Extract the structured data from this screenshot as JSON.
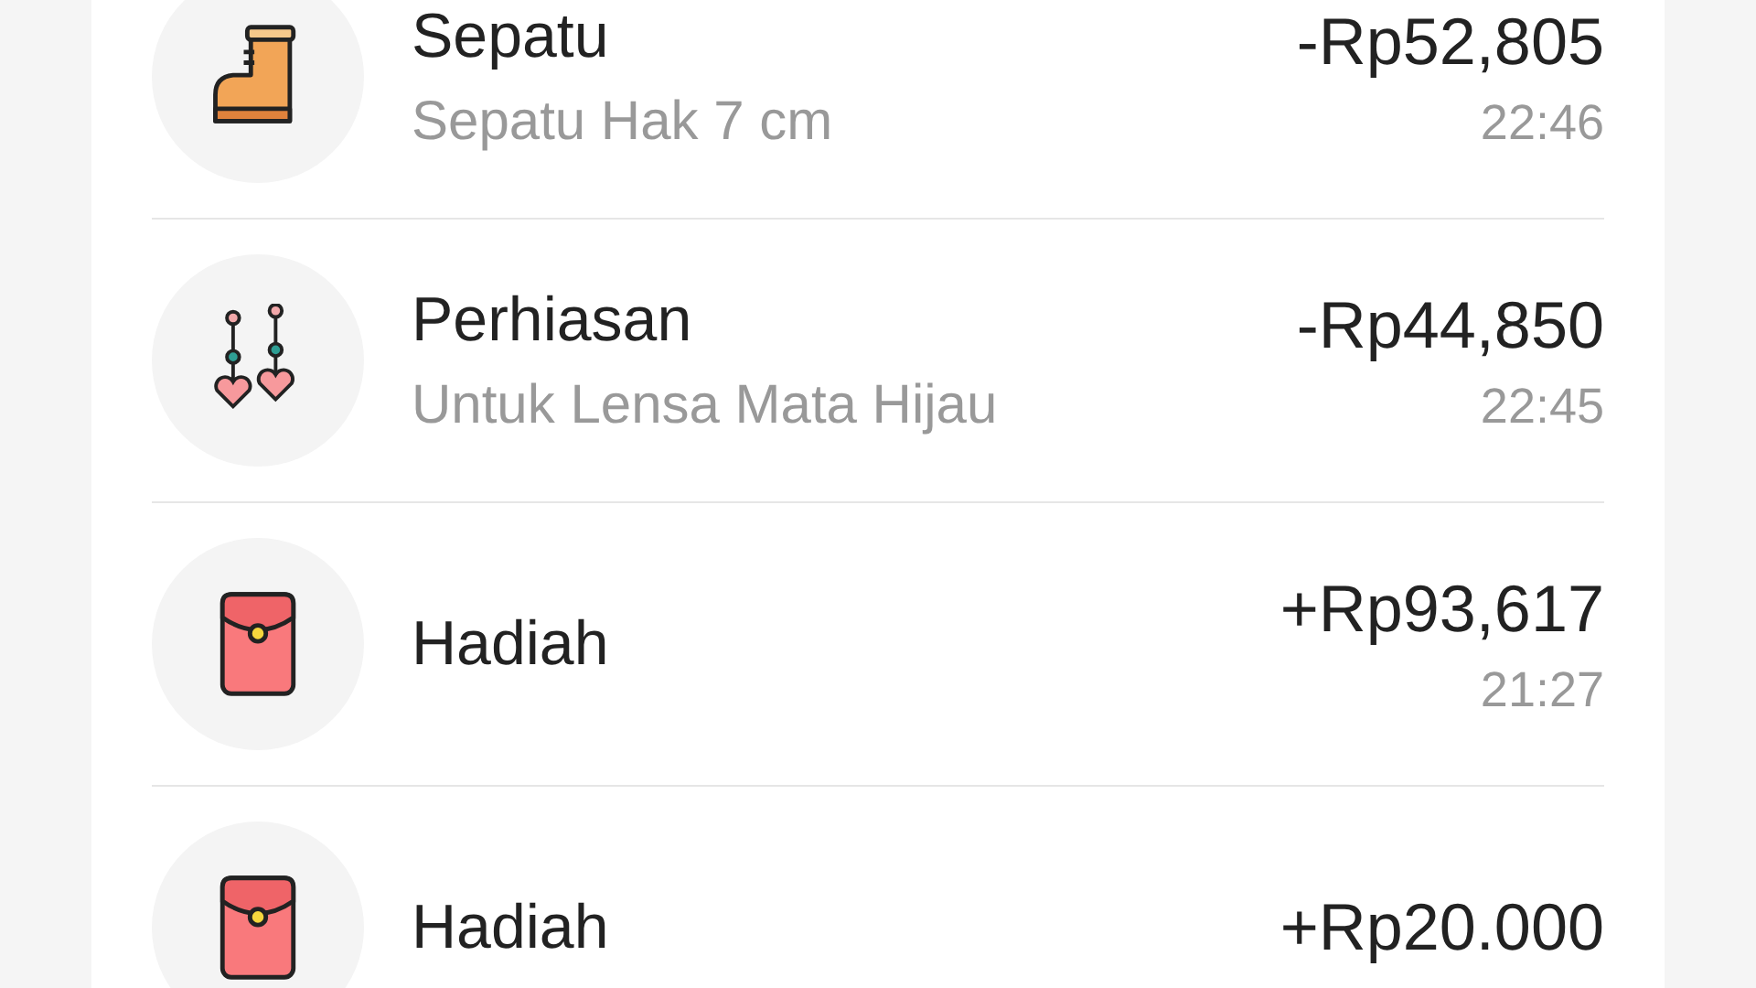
{
  "transactions": [
    {
      "kind": "boot",
      "title": "Sepatu",
      "note": "Sepatu Hak 7 cm",
      "amount": "-Rp52,805",
      "time": "22:46"
    },
    {
      "kind": "earrings",
      "title": "Perhiasan",
      "note": "Untuk Lensa Mata Hijau",
      "amount": "-Rp44,850",
      "time": "22:45"
    },
    {
      "kind": "envelope",
      "title": "Hadiah",
      "amount": "+Rp93,617",
      "time": "21:27"
    },
    {
      "kind": "envelope",
      "title": "Hadiah",
      "amount": "+Rp20.000"
    }
  ]
}
